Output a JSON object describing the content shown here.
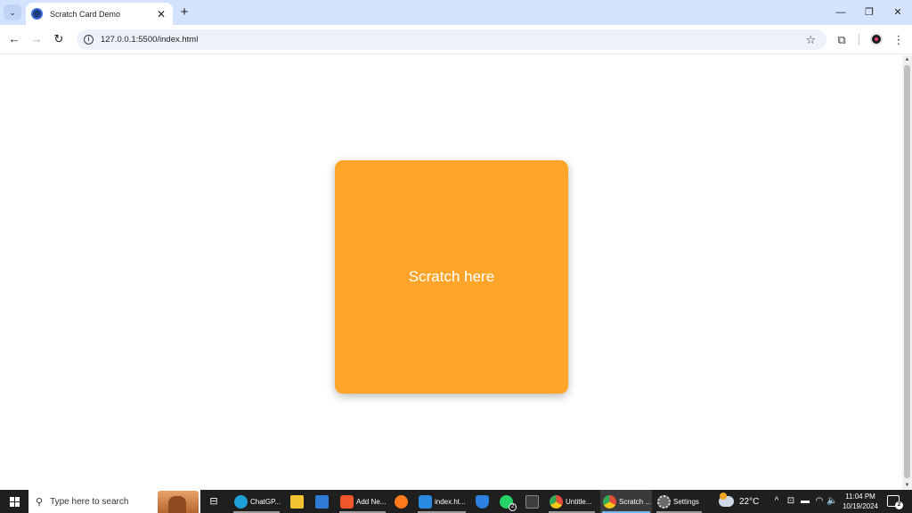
{
  "browser": {
    "tab": {
      "title": "Scratch Card Demo",
      "close_glyph": "✕"
    },
    "tab_search_glyph": "⌄",
    "new_tab_glyph": "+",
    "window_controls": {
      "minimize": "—",
      "restore": "❐",
      "close": "✕"
    },
    "nav": {
      "back": "←",
      "forward": "→",
      "reload": "↻"
    },
    "url": "127.0.0.1:5500/index.html",
    "info_glyph": "i",
    "star_glyph": "☆",
    "extensions_glyph": "⧉",
    "menu_glyph": "⋮"
  },
  "page": {
    "scratch_card": {
      "label": "Scratch here",
      "color": "#ffa62a"
    }
  },
  "scrollbar": {
    "up": "▲",
    "down": "▼"
  },
  "taskbar": {
    "search_placeholder": "Type here to search",
    "search_glyph": "⚲",
    "task_view_glyph": "⊟",
    "apps": [
      {
        "name": "edge",
        "label": "ChatGP...",
        "color": "#1fa0d8"
      },
      {
        "name": "file-explorer",
        "label": "",
        "color": "#f2c230"
      },
      {
        "name": "ms-store",
        "label": "",
        "color": "#2f7bd6"
      },
      {
        "name": "brave",
        "label": "Add Ne...",
        "color": "#f1562b"
      },
      {
        "name": "firefox",
        "label": "",
        "color": "#ff7a1a"
      },
      {
        "name": "vscode",
        "label": "index.ht...",
        "color": "#2a8ae0"
      },
      {
        "name": "defender",
        "label": "",
        "color": "#2d7fe0"
      },
      {
        "name": "whatsapp",
        "label": "",
        "color": "#25d366",
        "badge": "2"
      },
      {
        "name": "terminal",
        "label": "",
        "color": "#3d3d3d"
      },
      {
        "name": "chrome-1",
        "label": "Untitle...",
        "color": "#e64a3b"
      },
      {
        "name": "chrome-2",
        "label": "Scratch ...",
        "color": "#e64a3b"
      },
      {
        "name": "settings",
        "label": "Settings",
        "color": "#6b6b6b"
      }
    ],
    "weather": {
      "temp": "22°C"
    },
    "tray": {
      "chevron": "^",
      "meet": "⊡",
      "battery": "▬",
      "wifi": "◠",
      "volume": "🔈"
    },
    "clock": {
      "time": "11:04 PM",
      "date": "10/19/2024"
    },
    "notifications": {
      "count": "2"
    }
  }
}
